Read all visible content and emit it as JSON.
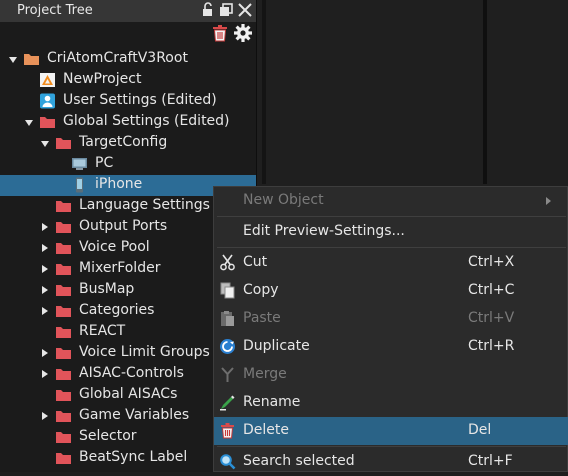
{
  "panel": {
    "title": "Project Tree"
  },
  "tree": [
    {
      "label": "CriAtomCraftV3Root",
      "icon": "folder-orange-icon",
      "arrow": "down"
    },
    {
      "label": "NewProject",
      "icon": "project-icon",
      "arrow": ""
    },
    {
      "label": "User Settings (Edited)",
      "icon": "user-settings-icon",
      "arrow": ""
    },
    {
      "label": "Global Settings (Edited)",
      "icon": "folder-red-icon",
      "arrow": "down"
    },
    {
      "label": "TargetConfig",
      "icon": "folder-red-icon",
      "arrow": "down"
    },
    {
      "label": "PC",
      "icon": "pc-icon",
      "arrow": ""
    },
    {
      "label": "iPhone",
      "icon": "phone-icon",
      "arrow": "",
      "selected": true
    },
    {
      "label": "Language Settings",
      "icon": "folder-red-icon",
      "arrow": ""
    },
    {
      "label": "Output Ports",
      "icon": "folder-red-icon",
      "arrow": "right"
    },
    {
      "label": "Voice Pool",
      "icon": "folder-red-icon",
      "arrow": "right"
    },
    {
      "label": "MixerFolder",
      "icon": "folder-red-icon",
      "arrow": "right"
    },
    {
      "label": "BusMap",
      "icon": "folder-red-icon",
      "arrow": "right"
    },
    {
      "label": "Categories",
      "icon": "folder-red-icon",
      "arrow": "right"
    },
    {
      "label": "REACT",
      "icon": "folder-red-icon",
      "arrow": ""
    },
    {
      "label": "Voice Limit Groups",
      "icon": "folder-red-icon",
      "arrow": "right"
    },
    {
      "label": "AISAC-Controls",
      "icon": "folder-red-icon",
      "arrow": "right"
    },
    {
      "label": "Global AISACs",
      "icon": "folder-red-icon",
      "arrow": ""
    },
    {
      "label": "Game Variables",
      "icon": "folder-red-icon",
      "arrow": "right"
    },
    {
      "label": "Selector",
      "icon": "folder-red-icon",
      "arrow": ""
    },
    {
      "label": "BeatSync Label",
      "icon": "folder-red-icon",
      "arrow": ""
    }
  ],
  "menu": [
    {
      "label": "New Object",
      "shortcut": "",
      "icon": "",
      "disabled": true,
      "submenu": true
    },
    {
      "sep": true
    },
    {
      "label": "Edit Preview-Settings...",
      "shortcut": "",
      "icon": "",
      "disabled": false
    },
    {
      "sep": true
    },
    {
      "label": "Cut",
      "shortcut": "Ctrl+X",
      "icon": "scissors-icon",
      "disabled": false
    },
    {
      "label": "Copy",
      "shortcut": "Ctrl+C",
      "icon": "copy-icon",
      "disabled": false
    },
    {
      "label": "Paste",
      "shortcut": "Ctrl+V",
      "icon": "paste-icon",
      "disabled": true
    },
    {
      "label": "Duplicate",
      "shortcut": "Ctrl+R",
      "icon": "duplicate-icon",
      "disabled": false
    },
    {
      "label": "Merge",
      "shortcut": "",
      "icon": "merge-icon",
      "disabled": true
    },
    {
      "label": "Rename",
      "shortcut": "",
      "icon": "rename-icon",
      "disabled": false
    },
    {
      "label": "Delete",
      "shortcut": "Del",
      "icon": "trash-icon",
      "disabled": false,
      "highlighted": true
    },
    {
      "sep": true
    },
    {
      "label": "Search selected",
      "shortcut": "Ctrl+F",
      "icon": "search-icon",
      "disabled": false
    }
  ],
  "colors": {
    "selection": "#2c6c96",
    "menu_highlight": "#2a6387",
    "folder_red": "#e0555a",
    "folder_orange": "#e8925a"
  }
}
